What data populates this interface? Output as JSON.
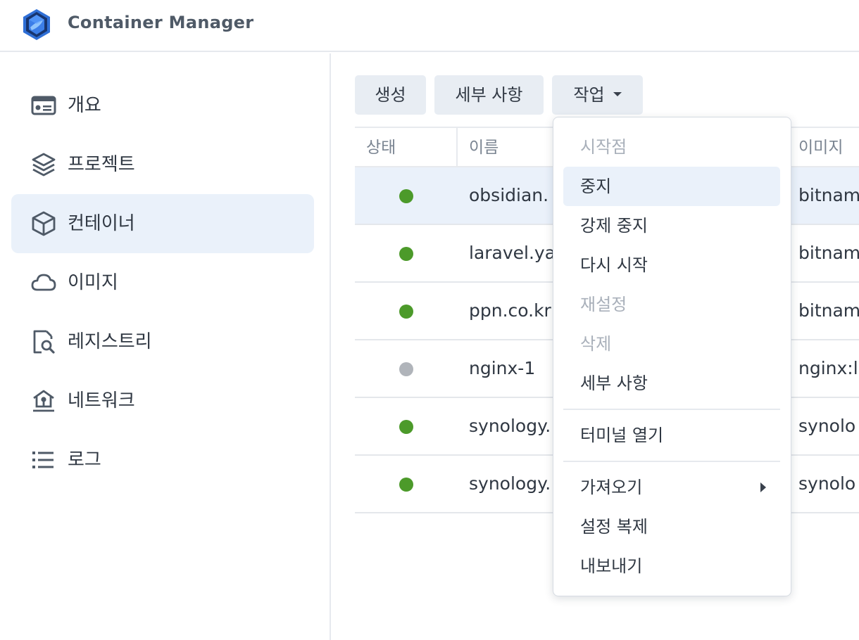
{
  "app": {
    "title": "Container Manager"
  },
  "sidebar": {
    "items": [
      {
        "label": "개요",
        "icon": "overview-card-icon",
        "active": false
      },
      {
        "label": "프로젝트",
        "icon": "layers-icon",
        "active": false
      },
      {
        "label": "컨테이너",
        "icon": "cube-icon",
        "active": true
      },
      {
        "label": "이미지",
        "icon": "cloud-icon",
        "active": false
      },
      {
        "label": "레지스트리",
        "icon": "registry-search-icon",
        "active": false
      },
      {
        "label": "네트워크",
        "icon": "network-house-icon",
        "active": false
      },
      {
        "label": "로그",
        "icon": "list-icon",
        "active": false
      }
    ]
  },
  "toolbar": {
    "create_label": "생성",
    "details_label": "세부 사항",
    "action_label": "작업"
  },
  "table": {
    "columns": [
      "상태",
      "이름",
      "이미지"
    ],
    "rows": [
      {
        "status": "running",
        "name": "obsidian.",
        "image": "bitnam",
        "selected": true
      },
      {
        "status": "running",
        "name": "laravel.ya",
        "image": "bitnam",
        "selected": false
      },
      {
        "status": "running",
        "name": "ppn.co.kr",
        "image": "bitnam",
        "selected": false
      },
      {
        "status": "stopped",
        "name": "nginx-1",
        "image": "nginx:l",
        "selected": false
      },
      {
        "status": "running",
        "name": "synology.",
        "image": "synolo",
        "selected": false
      },
      {
        "status": "running",
        "name": "synology.",
        "image": "synolo",
        "selected": false
      }
    ]
  },
  "action_menu": {
    "items": [
      {
        "label": "시작점",
        "disabled": true
      },
      {
        "label": "중지",
        "disabled": false,
        "hover": true
      },
      {
        "label": "강제 중지",
        "disabled": false
      },
      {
        "label": "다시 시작",
        "disabled": false
      },
      {
        "label": "재설정",
        "disabled": true
      },
      {
        "label": "삭제",
        "disabled": true
      },
      {
        "label": "세부 사항",
        "disabled": false
      },
      {
        "label": "터미널 열기",
        "disabled": false
      },
      {
        "label": "가져오기",
        "disabled": false,
        "submenu": true
      },
      {
        "label": "설정 복제",
        "disabled": false
      },
      {
        "label": "내보내기",
        "disabled": false
      }
    ]
  },
  "colors": {
    "accent_bg": "#eaf1fa",
    "running": "#4c9a2a",
    "stopped": "#b0b4ba",
    "button_bg": "#e8edf3"
  }
}
